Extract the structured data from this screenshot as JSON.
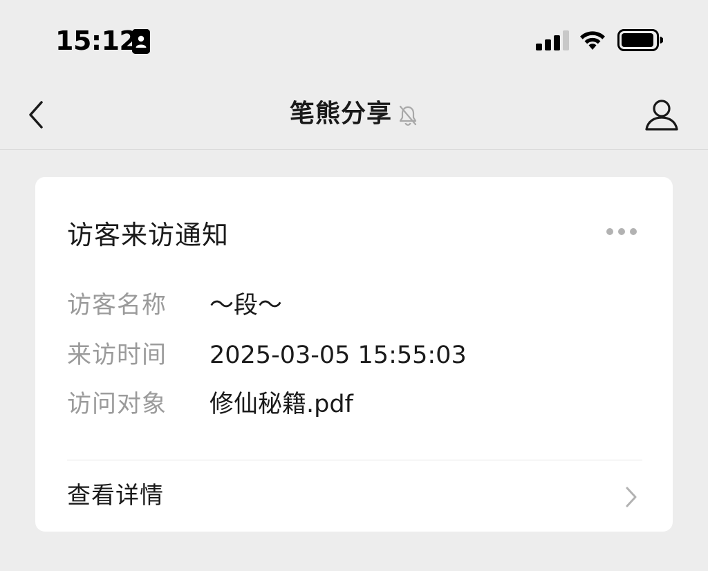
{
  "status_bar": {
    "time": "15:12",
    "icons": [
      "badge-icon",
      "signal-icon",
      "wifi-icon",
      "battery-icon"
    ]
  },
  "nav": {
    "title": "笔熊分享",
    "icons": [
      "back-icon",
      "mute-icon",
      "profile-icon"
    ]
  },
  "card": {
    "title": "访客来访通知",
    "rows": [
      {
        "label": "访客名称",
        "value": "～段～"
      },
      {
        "label": "来访时间",
        "value": "2025-03-05 15:55:03"
      },
      {
        "label": "访问对象",
        "value": "修仙秘籍.pdf"
      }
    ],
    "detail_label": "查看详情"
  },
  "colors": {
    "background": "#ededed",
    "card": "#ffffff",
    "label": "#9b9b9b",
    "text": "#1a1a1a"
  }
}
